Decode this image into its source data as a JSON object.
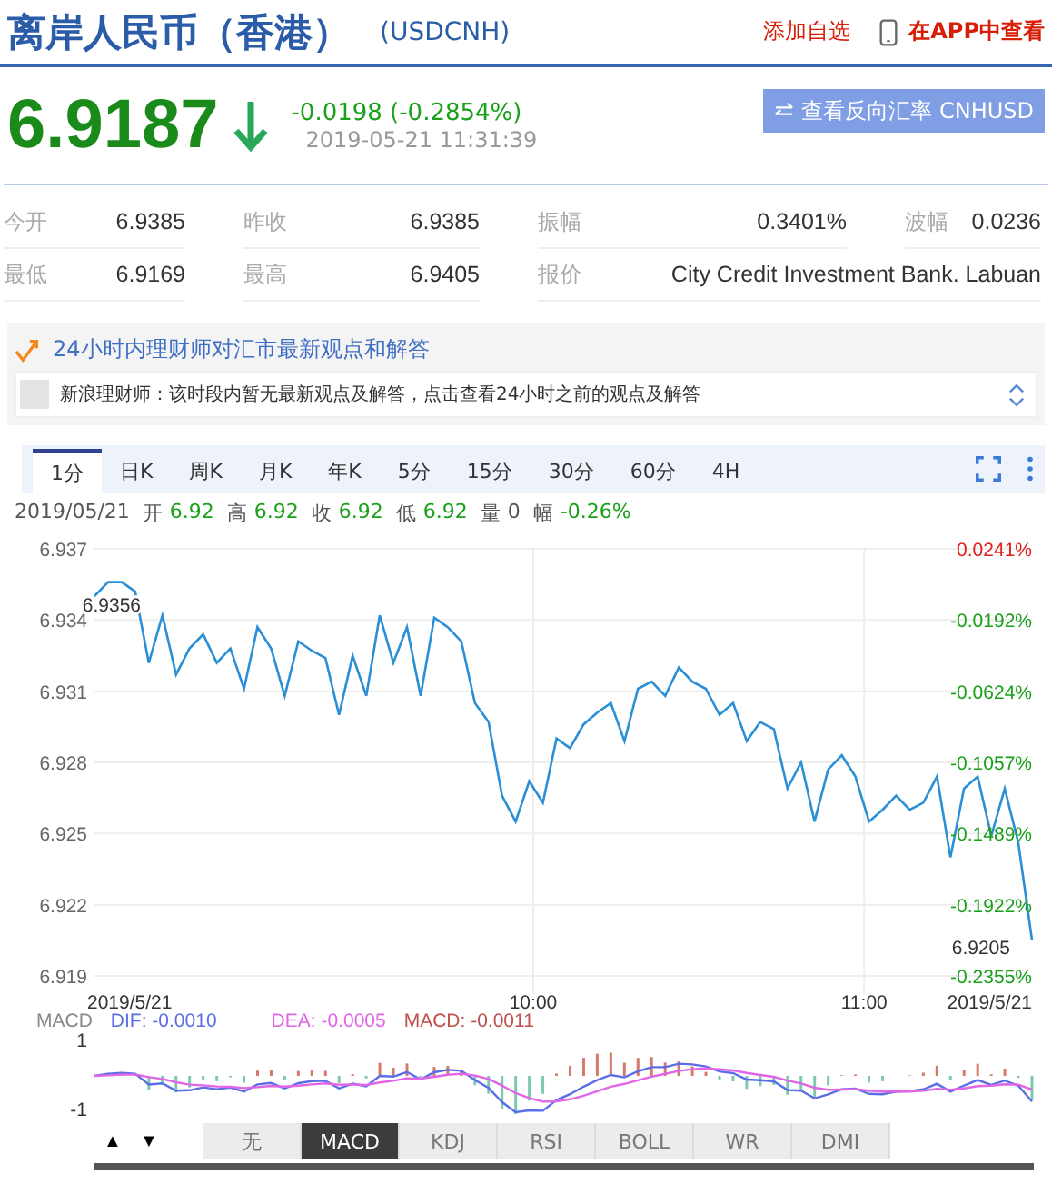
{
  "header": {
    "title": "离岸人民币（香港）",
    "code": "(USDCNH)",
    "watch_link": "添加自选",
    "app_link": "在APP中查看"
  },
  "quote": {
    "price": "6.9187",
    "change": "-0.0198 (-0.2854%)",
    "time": "2019-05-21 11:31:39",
    "reverse_button": "查看反向汇率 CNHUSD"
  },
  "stats": [
    {
      "label": "今开",
      "value": "6.9385"
    },
    {
      "label": "昨收",
      "value": "6.9385"
    },
    {
      "label": "振幅",
      "value": "0.3401%"
    },
    {
      "label": "波幅",
      "value": "0.0236"
    },
    {
      "label": "最低",
      "value": "6.9169"
    },
    {
      "label": "最高",
      "value": "6.9405"
    },
    {
      "label": "报价",
      "value": "City Credit Investment Bank. Labuan"
    }
  ],
  "advice": {
    "title": "24小时内理财师对汇市最新观点和解答",
    "message": "新浪理财师：该时段内暂无最新观点及解答，点击查看24小时之前的观点及解答"
  },
  "tabs": [
    {
      "label": "1分",
      "selected": true
    },
    {
      "label": "日K",
      "selected": false
    },
    {
      "label": "周K",
      "selected": false
    },
    {
      "label": "月K",
      "selected": false
    },
    {
      "label": "年K",
      "selected": false
    },
    {
      "label": "5分",
      "selected": false
    },
    {
      "label": "15分",
      "selected": false
    },
    {
      "label": "30分",
      "selected": false
    },
    {
      "label": "60分",
      "selected": false
    },
    {
      "label": "4H",
      "selected": false
    }
  ],
  "bar_info": {
    "date": "2019/05/21",
    "prices": [
      {
        "label": "开",
        "value": "6.92"
      },
      {
        "label": "高",
        "value": "6.92"
      },
      {
        "label": "收",
        "value": "6.92"
      },
      {
        "label": "低",
        "value": "6.92"
      }
    ],
    "volume": {
      "label": "量",
      "value": "0"
    },
    "range": {
      "label": "幅",
      "value": "-0.26%"
    }
  },
  "chart": {
    "chart_data": {
      "type": "line",
      "grid": true,
      "ylim": [
        6.919,
        6.937
      ],
      "yticks": [
        6.937,
        6.934,
        6.931,
        6.928,
        6.925,
        6.922,
        6.919
      ],
      "series": [
        {
          "color": "#2b8fd6",
          "values": [
            6.935,
            6.9356,
            6.9356,
            6.9352,
            6.9322,
            6.9342,
            6.9317,
            6.9328,
            6.9334,
            6.9322,
            6.9328,
            6.9311,
            6.9337,
            6.9328,
            6.9308,
            6.9331,
            6.9327,
            6.9324,
            6.93,
            6.9325,
            6.9308,
            6.9342,
            6.9322,
            6.9337,
            6.9308,
            6.9341,
            6.9337,
            6.9331,
            6.9305,
            6.9297,
            6.9266,
            6.9255,
            6.9272,
            6.9263,
            6.929,
            6.9286,
            6.9296,
            6.9301,
            6.9305,
            6.9289,
            6.9311,
            6.9314,
            6.9308,
            6.932,
            6.9314,
            6.9311,
            6.93,
            6.9305,
            6.9289,
            6.9297,
            6.9294,
            6.9269,
            6.928,
            6.9255,
            6.9277,
            6.9283,
            6.9274,
            6.9255,
            6.926,
            6.9266,
            6.926,
            6.9263,
            6.9274,
            6.924,
            6.9269,
            6.9274,
            6.9249,
            6.9269,
            6.9246,
            6.9205
          ]
        }
      ]
    },
    "x_labels": [
      "2019/5/21",
      "10:00",
      "11:00",
      "2019/5/21"
    ],
    "high_label": "6.9356",
    "last_label": "6.9205",
    "right_axis": [
      {
        "label": "0.0241%",
        "color": "#e0201b"
      },
      {
        "label": "-0.0192%",
        "color": "#1aa01a"
      },
      {
        "label": "-0.0624%",
        "color": "#1aa01a"
      },
      {
        "label": "-0.1057%",
        "color": "#1aa01a"
      },
      {
        "label": "-0.1489%",
        "color": "#1aa01a"
      },
      {
        "label": "-0.1922%",
        "color": "#1aa01a"
      },
      {
        "label": "-0.2355%",
        "color": "#1aa01a"
      }
    ]
  },
  "macd": {
    "legend": [
      {
        "label": "MACD",
        "color": "#888888"
      },
      {
        "label": "DIF: -0.0010",
        "color": "#5b6ee8"
      },
      {
        "label": "DEA: -0.0005",
        "color": "#e066e6"
      },
      {
        "label": "MACD: -0.0011",
        "color": "#c0504d"
      }
    ],
    "axis_labels": [
      "1",
      "-1"
    ]
  },
  "indicators": {
    "arrows": [
      "▲",
      "▼"
    ],
    "tabs": [
      {
        "label": "无",
        "selected": false
      },
      {
        "label": "MACD",
        "selected": true
      },
      {
        "label": "KDJ",
        "selected": false
      },
      {
        "label": "RSI",
        "selected": false
      },
      {
        "label": "BOLL",
        "selected": false
      },
      {
        "label": "WR",
        "selected": false
      },
      {
        "label": "DMI",
        "selected": false
      }
    ]
  }
}
